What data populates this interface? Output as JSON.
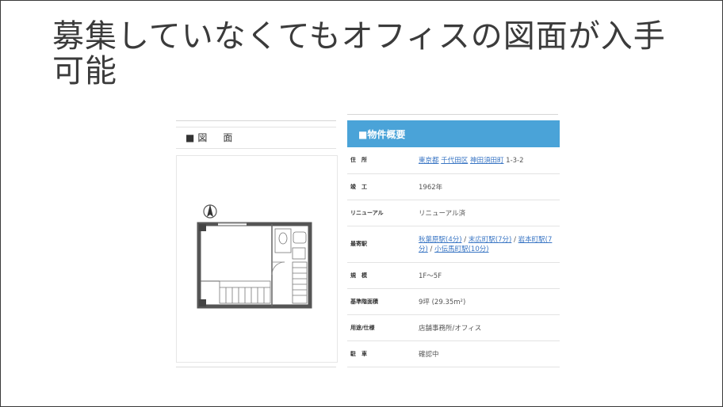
{
  "slide": {
    "title": "募集していなくてもオフィスの図面が入手可能"
  },
  "listing": {
    "floorplan_heading": "■図　面",
    "summary_heading": "■物件概要",
    "accent_color": "#4aa3d8",
    "rows": [
      {
        "label": "住　所",
        "links": [
          "東京都",
          "千代田区",
          "神田須田町"
        ],
        "text": "1-3-2",
        "height": 33
      },
      {
        "label": "竣　工",
        "text": "1962年",
        "height": 33
      },
      {
        "label": "リニューアル",
        "text": "リニューアル済",
        "height": 33
      },
      {
        "label": "最寄駅",
        "links": [
          "秋葉原駅(4分)",
          "末広町駅(7分)",
          "岩本町駅(7分)",
          "小伝馬町駅(10分)"
        ],
        "height": 46
      },
      {
        "label": "規　模",
        "text": "1F〜5F",
        "height": 33
      },
      {
        "label": "基準階面積",
        "text": "9坪 (29.35m²)",
        "height": 33
      },
      {
        "label": "用途/仕様",
        "text": "店舗事務所/オフィス",
        "height": 33
      },
      {
        "label": "駐　車",
        "text": "確認中",
        "height": 33
      }
    ]
  }
}
